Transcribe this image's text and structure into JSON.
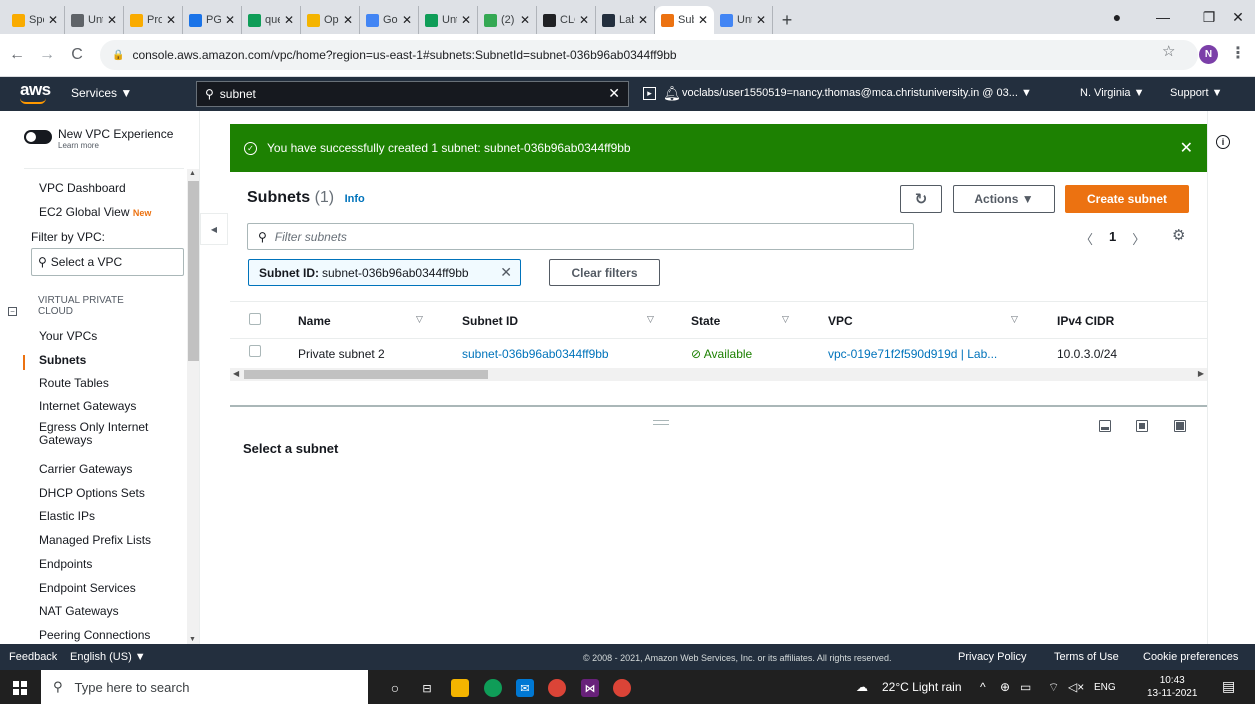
{
  "browser": {
    "tabs": [
      {
        "label": "Spe",
        "color": "#f9ab00"
      },
      {
        "label": "Unti",
        "color": "#5f6368"
      },
      {
        "label": "Proj",
        "color": "#f9ab00"
      },
      {
        "label": "PG",
        "color": "#1a73e8"
      },
      {
        "label": "que",
        "color": "#0f9d58"
      },
      {
        "label": "Ope",
        "color": "#f4b400"
      },
      {
        "label": "Goo",
        "color": "#4285f4"
      },
      {
        "label": "Unt",
        "color": "#0f9d58"
      },
      {
        "label": "(2)",
        "color": "#34a853"
      },
      {
        "label": "CLC",
        "color": "#202124"
      },
      {
        "label": "Lab",
        "color": "#232f3e"
      },
      {
        "label": "Sub",
        "color": "#ec7211"
      },
      {
        "label": "Unt",
        "color": "#4285f4"
      }
    ],
    "new_tab": "+",
    "url": "console.aws.amazon.com/vpc/home?region=us-east-1#subnets:SubnetId=subnet-036b96ab0344ff9bb",
    "profile_initial": "N"
  },
  "awsnav": {
    "logo": "aws",
    "services": "Services ▼",
    "search_value": "subnet",
    "account": "voclabs/user1550519=nancy.thomas@mca.christuniversity.in @ 03... ▼",
    "region": "N. Virginia ▼",
    "support": "Support ▼"
  },
  "sidebar": {
    "toggle_label": "New VPC Experience",
    "toggle_sub": "Learn more",
    "dashboard": "VPC Dashboard",
    "ec2_global": "EC2 Global View",
    "new_badge": "New",
    "filter_label": "Filter by VPC:",
    "vpc_select_placeholder": "Select a VPC",
    "section_line1": "VIRTUAL PRIVATE",
    "section_line2": "CLOUD",
    "items": [
      "Your VPCs",
      "Subnets",
      "Route Tables",
      "Internet Gateways",
      "Egress Only Internet",
      "Gateways",
      "Carrier Gateways",
      "DHCP Options Sets",
      "Elastic IPs",
      "Managed Prefix Lists",
      "Endpoints",
      "Endpoint Services",
      "NAT Gateways",
      "Peering Connections"
    ]
  },
  "flash": {
    "message": "You have successfully created 1 subnet: subnet-036b96ab0344ff9bb"
  },
  "panel": {
    "title": "Subnets",
    "count": "(1)",
    "info": "Info",
    "actions": "Actions ▼",
    "create": "Create subnet",
    "filter_placeholder": "Filter subnets",
    "page": "1",
    "token_key": "Subnet ID:",
    "token_value": "subnet-036b96ab0344ff9bb",
    "clear_filters": "Clear filters",
    "columns": [
      "Name",
      "Subnet ID",
      "State",
      "VPC",
      "IPv4 CIDR"
    ],
    "rows": [
      {
        "name": "Private subnet 2",
        "subnet_id": "subnet-036b96ab0344ff9bb",
        "state": "Available",
        "vpc": "vpc-019e71f2f590d919d | Lab...",
        "cidr": "10.0.3.0/24"
      }
    ],
    "select_prompt": "Select a subnet"
  },
  "footer": {
    "feedback": "Feedback",
    "language": "English (US) ▼",
    "copyright": "© 2008 - 2021, Amazon Web Services, Inc. or its affiliates. All rights reserved.",
    "privacy": "Privacy Policy",
    "terms": "Terms of Use",
    "cookies": "Cookie preferences"
  },
  "taskbar": {
    "search_placeholder": "Type here to search",
    "weather": "22°C  Light rain",
    "lang": "ENG",
    "time": "10:43",
    "date": "13-11-2021"
  }
}
